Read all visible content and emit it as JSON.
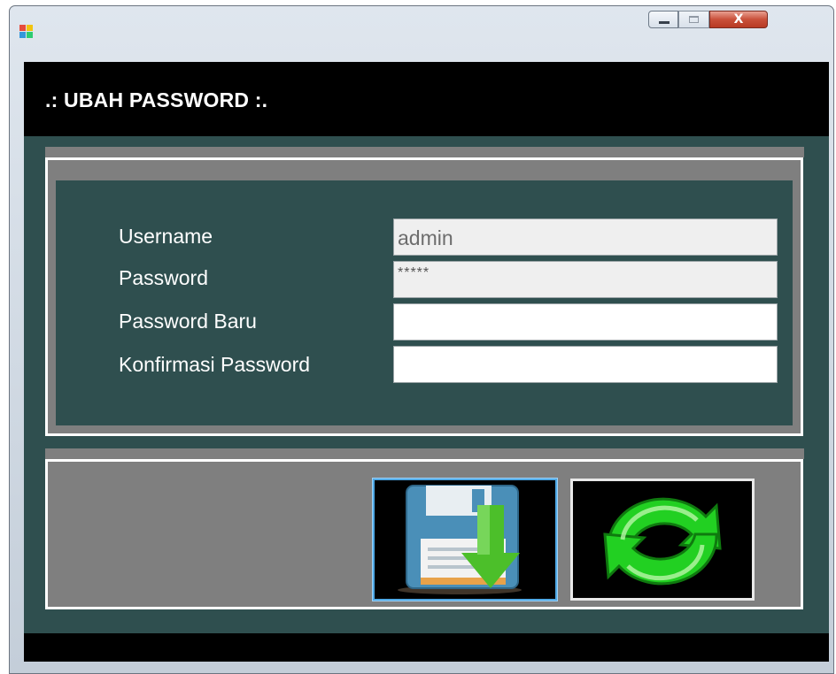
{
  "window": {
    "app_icon": "windows-form-icon",
    "controls": [
      "minimize-icon",
      "maximize-icon",
      "close-icon"
    ],
    "close_glyph": "X"
  },
  "header": {
    "title": ".: UBAH PASSWORD :."
  },
  "form": {
    "username": {
      "label": "Username",
      "value": "admin"
    },
    "password": {
      "label": "Password",
      "value": "*****"
    },
    "new_password": {
      "label": "Password Baru",
      "value": ""
    },
    "confirm_password": {
      "label": "Konfirmasi Password",
      "value": ""
    }
  },
  "buttons": {
    "save": {
      "icon": "floppy-save-icon"
    },
    "reset": {
      "icon": "refresh-icon"
    }
  },
  "colors": {
    "panel": "#2f4f4f",
    "header": "#000000",
    "group": "#7f7f7f",
    "save_border": "#4fa9e6",
    "refresh_green": "#22d022"
  }
}
